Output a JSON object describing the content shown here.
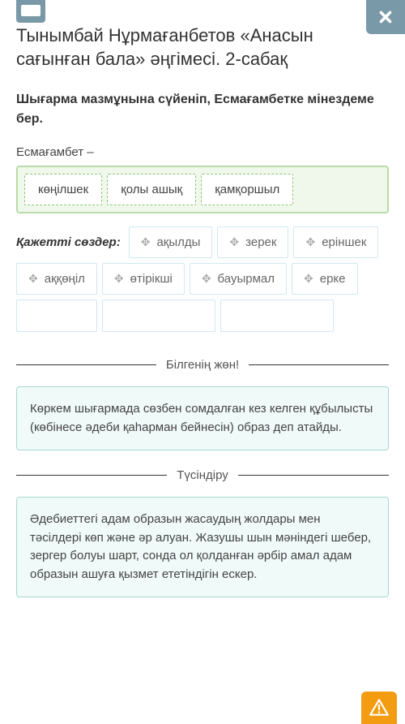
{
  "title": "Тынымбай Нұрмағанбетов «Анасын сағынған бала» әңгімесі. 2-сабақ",
  "instruction": "Шығарма мазмұнына сүйеніп, Есмағамбетке мінездеме бер.",
  "subject_label": "Есмағамбет –",
  "answers": [
    "көңілшек",
    "қолы ашық",
    "қамқоршыл"
  ],
  "words_label": "Қажетті сөздер:",
  "available_words": [
    "ақылды",
    "зерек",
    "еріншек",
    "аққөңіл",
    "өтірікші",
    "бауырмал",
    "ерке"
  ],
  "divider1": "Білгенің жөн!",
  "info1": "Көркем шығармада сөзбен сомдалған кез келген құбылысты (көбінесе әдеби қаһарман бейнесін) образ деп атайды.",
  "divider2": "Түсіндіру",
  "info2": "Әдебиеттегі адам образын жасаудың жолдары мен тәсілдері көп және әр алуан. Жазушы шын мәніндегі шебер, зергер болуы шарт, сонда ол қолданған әрбір амал адам образын ашуға қызмет ететіндігін ескер."
}
